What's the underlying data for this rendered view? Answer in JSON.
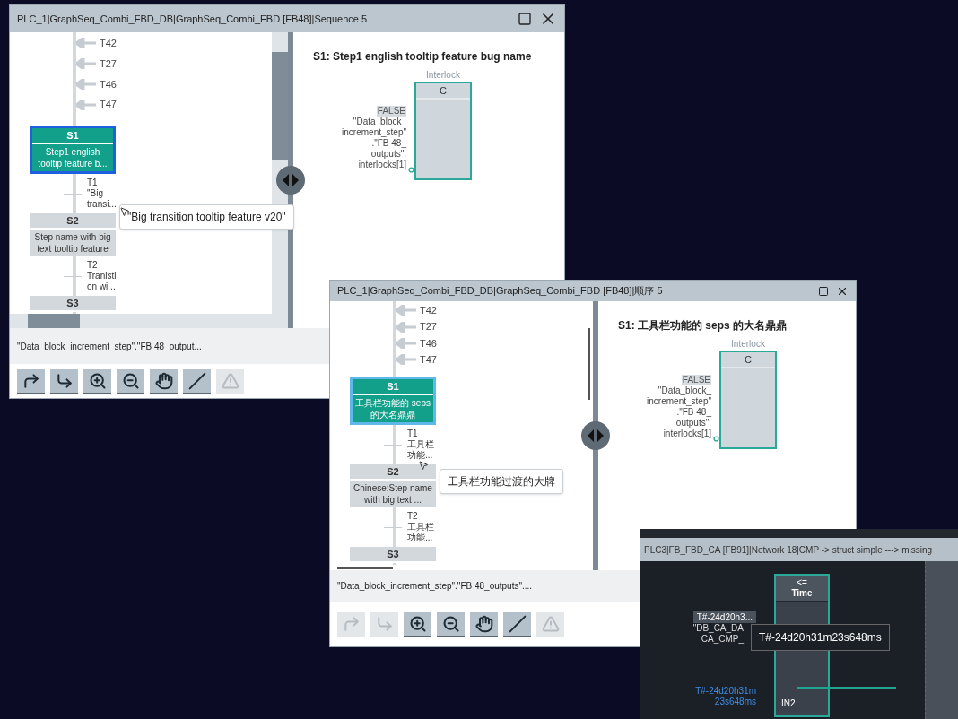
{
  "graph_windows": [
    {
      "title": "PLC_1|GraphSeq_Combi_FBD_DB|GraphSeq_Combi_FBD [FB48]|Sequence 5",
      "jumps": [
        "T42",
        "T27",
        "T46",
        "T47"
      ],
      "sequence": [
        {
          "kind": "step",
          "number": "S1",
          "name": "Step1 english\ntooltip feature b...",
          "selected": true
        },
        {
          "kind": "transition",
          "number": "T1",
          "name": "\"Big\ntransi..."
        },
        {
          "kind": "step",
          "number": "S2",
          "name": "Step name with big\ntext tooltip feature",
          "selected": false
        },
        {
          "kind": "transition",
          "number": "T2",
          "name": "Tranisti\non wi..."
        },
        {
          "kind": "step",
          "number": "S3",
          "selected": false
        }
      ],
      "tooltip": "\"Big transition tooltip feature v20\"",
      "detail": {
        "title": "S1: Step1 english tooltip feature bug name",
        "block_caption": "Interlock",
        "block_label": "C",
        "operand_value": "FALSE",
        "operand": "\"Data_block_\nincrement_step\"\n.\"FB 48_\noutputs\".\ninterlocks[1]"
      },
      "status_text": "\"Data_block_increment_step\".\"FB 48_output...",
      "toolbar": [
        {
          "kind": "goto-up",
          "disabled": false
        },
        {
          "kind": "goto-down",
          "disabled": false
        },
        {
          "kind": "zoom-in",
          "disabled": false
        },
        {
          "kind": "zoom-out",
          "disabled": false
        },
        {
          "kind": "pan",
          "disabled": false
        },
        {
          "kind": "signal",
          "disabled": false
        },
        {
          "kind": "warning",
          "disabled": true
        }
      ]
    },
    {
      "title": "PLC_1|GraphSeq_Combi_FBD_DB|GraphSeq_Combi_FBD [FB48]|顺序 5",
      "jumps": [
        "T42",
        "T27",
        "T46",
        "T47"
      ],
      "sequence": [
        {
          "kind": "step",
          "number": "S1",
          "name": "工具栏功能的 seps\n的大名鼎鼎",
          "selected": true
        },
        {
          "kind": "transition",
          "number": "T1",
          "name": "工具栏功能..."
        },
        {
          "kind": "step",
          "number": "S2",
          "name": "Chinese:Step name\nwith big text ...",
          "selected": false
        },
        {
          "kind": "transition",
          "number": "T2",
          "name": "工具栏功能..."
        },
        {
          "kind": "step",
          "number": "S3",
          "selected": false
        }
      ],
      "tooltip": "工具栏功能过渡的大牌",
      "detail": {
        "title": "S1: 工具栏功能的 seps 的大名鼎鼎",
        "block_caption": "Interlock",
        "block_label": "C",
        "operand_value": "FALSE",
        "operand": "\"Data_block_\nincrement_step\"\n.\"FB 48_\noutputs\".\ninterlocks[1]"
      },
      "status_text": "\"Data_block_increment_step\".\"FB 48_outputs\"....",
      "toolbar": [
        {
          "kind": "goto-up",
          "disabled": true
        },
        {
          "kind": "goto-down",
          "disabled": true
        },
        {
          "kind": "zoom-in",
          "disabled": false
        },
        {
          "kind": "zoom-out",
          "disabled": false
        },
        {
          "kind": "pan",
          "disabled": false
        },
        {
          "kind": "signal",
          "disabled": false
        },
        {
          "kind": "warning",
          "disabled": true
        }
      ]
    }
  ],
  "fbd_window": {
    "title": "PLC3|FB_FBD_CA [FB91]|Network 18|CMP -> struct simple ---> missing",
    "operand_value": "T#-24d20h3...",
    "operand_lines": [
      "\"DB_CA_DA",
      "CA_CMP_"
    ],
    "tooltip": "T#-24d20h31m23s648ms",
    "block_operator": "<=",
    "block_type": "Time",
    "pin": "IN2",
    "operand2": "T#-24d20h31m\n23s648ms"
  }
}
